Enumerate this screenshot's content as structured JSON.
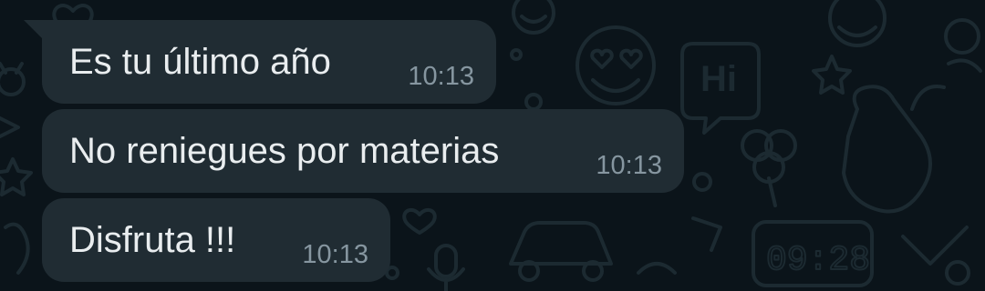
{
  "chat": {
    "messages": [
      {
        "text": "Es tu último año",
        "time": "10:13"
      },
      {
        "text": "No reniegues por materias",
        "time": "10:13"
      },
      {
        "text": "Disfruta !!!",
        "time": "10:13"
      }
    ]
  },
  "wallpaper": {
    "clock_text": "09:28",
    "hi_text": "Hi"
  },
  "colors": {
    "background": "#0b141a",
    "bubble": "#202c33",
    "message_text": "#e9edef",
    "timestamp": "#8696a0",
    "doodle": "#1c2a31"
  },
  "icons": [
    "heart-icon",
    "smile-icon",
    "heart-eyes-icon",
    "star-icon",
    "hand-icon",
    "clover-icon",
    "car-icon",
    "alarm-clock-icon",
    "microphone-icon",
    "cat-icon",
    "speech-bubble-icon"
  ]
}
